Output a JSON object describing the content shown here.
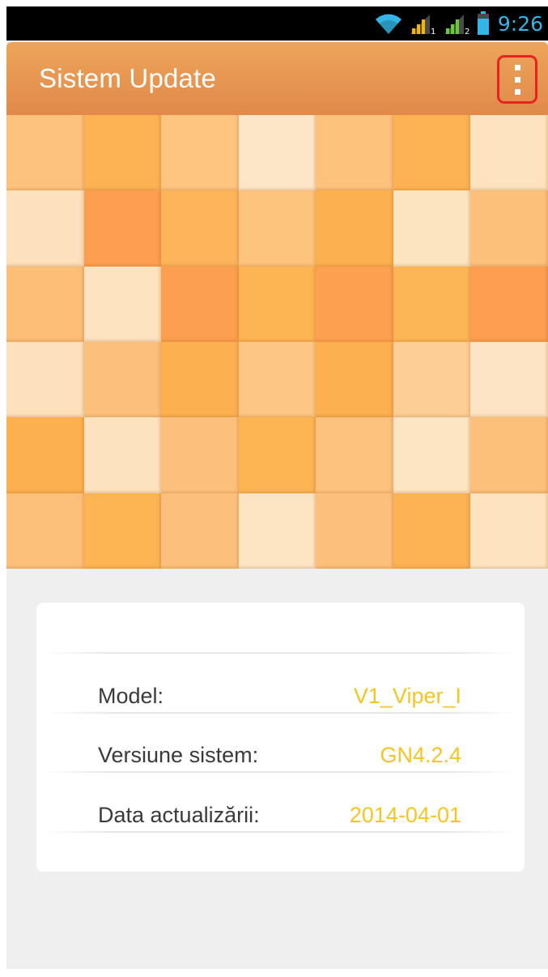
{
  "status_bar": {
    "time": "9:26",
    "icons": [
      "wifi-icon",
      "signal-sim1-icon",
      "signal-sim2-icon",
      "battery-icon"
    ],
    "time_color": "#33b5e5"
  },
  "app_bar": {
    "title": "Sistem Update",
    "overflow_icon": "overflow-menu-icon",
    "colors": {
      "top": "#eda55a",
      "bottom": "#e1894a",
      "highlight": "#e8231f"
    }
  },
  "mosaic": {
    "colors": [
      [
        "#fdc37e",
        "#fdb253",
        "#fdc57f",
        "#fde6c7",
        "#fdc27c",
        "#fdb253",
        "#fde3be"
      ],
      [
        "#fde0bc",
        "#fd9e50",
        "#fdb45a",
        "#fdc47e",
        "#fdb050",
        "#fde4c0",
        "#fdc07a"
      ],
      [
        "#fdbe78",
        "#fde3c0",
        "#fd9f50",
        "#fdb452",
        "#fda050",
        "#fdb655",
        "#fd9e50"
      ],
      [
        "#fde0bc",
        "#fdc07c",
        "#fdb050",
        "#fdc684",
        "#fdb050",
        "#fdce96",
        "#fde4c4"
      ],
      [
        "#fdb050",
        "#fde2bf",
        "#fdc07c",
        "#fdb453",
        "#fdc27e",
        "#fde4c3",
        "#fdc07a"
      ],
      [
        "#fdc07a",
        "#fdb452",
        "#fdc07c",
        "#fde5c4",
        "#fdc07c",
        "#fdb253",
        "#fde3bf"
      ]
    ]
  },
  "info_card": {
    "rows": [
      {
        "label": "Model:",
        "value": "V1_Viper_I"
      },
      {
        "label": "Versiune sistem:",
        "value": "GN4.2.4"
      },
      {
        "label": "Data actualizării:",
        "value": "2014-04-01"
      }
    ],
    "value_color": "#f4c524"
  }
}
